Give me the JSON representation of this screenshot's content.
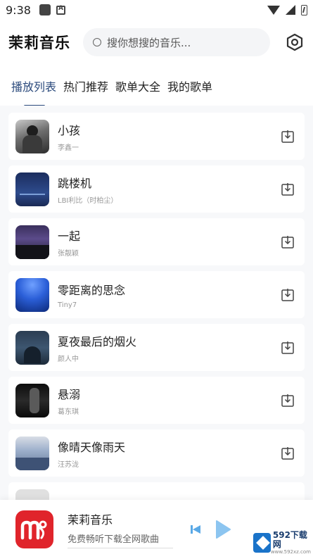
{
  "status_bar": {
    "time": "9:38"
  },
  "header": {
    "app_title": "茉莉音乐",
    "search_placeholder": "搜你想搜的音乐..."
  },
  "tabs": [
    {
      "label": "播放列表",
      "active": true
    },
    {
      "label": "热门推荐",
      "active": false
    },
    {
      "label": "歌单大全",
      "active": false
    },
    {
      "label": "我的歌单",
      "active": false
    }
  ],
  "songs": [
    {
      "title": "小孩",
      "artist": "李鑫一"
    },
    {
      "title": "跳楼机",
      "artist": "LBI利比（时柏尘）"
    },
    {
      "title": "一起",
      "artist": "张靓颖"
    },
    {
      "title": "零距离的思念",
      "artist": "Tiny7"
    },
    {
      "title": "夏夜最后的烟火",
      "artist": "颜人中"
    },
    {
      "title": "悬溺",
      "artist": "葛东琪"
    },
    {
      "title": "像晴天像雨天",
      "artist": "汪苏泷"
    }
  ],
  "player": {
    "title": "茉莉音乐",
    "subtitle": "免费畅听下载全网歌曲"
  },
  "watermark": {
    "text": "592下载网",
    "sub": "www.592xz.com"
  },
  "colors": {
    "accent": "#2b4a7c",
    "brand_red": "#e0242b",
    "play_blue": "#5aa9e6"
  }
}
